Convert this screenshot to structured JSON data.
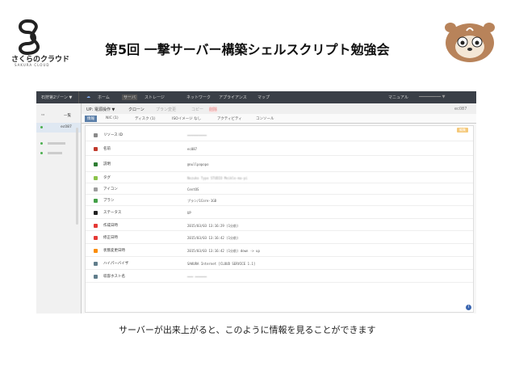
{
  "slide": {
    "title": "第5回 一撃サーバー構築シェルスクリプト勉強会",
    "caption": "サーバーが出来上がると、このように情報を見ることができます",
    "logo_text": "さくらのクラウド",
    "logo_sub": "SAKURA CLOUD"
  },
  "app": {
    "topbar": {
      "zone": "石狩第2ゾーン ▼",
      "home": "ホーム",
      "server": "サーバ",
      "storage": "ストレージ",
      "network": "ネットワーク",
      "appliance": "アプライアンス",
      "map": "マップ",
      "manual": "マニュアル",
      "account": "━━━━━━━━━ ▼"
    },
    "sidebar": {
      "header": "一覧",
      "selected": "ec087"
    },
    "toolbar": {
      "power": "UP: 電源操作 ▼",
      "clone": "クローン",
      "plan_change": "プラン変更",
      "copy": "コピー",
      "delete": "削除",
      "server_id": "ec087"
    },
    "tabs": {
      "info": "情報",
      "nic": "NIC (1)",
      "disk": "ディスク (1)",
      "iso": "ISOイメージ なし",
      "activity": "アクティビティ",
      "console": "コンソール"
    },
    "edit_button": "編集",
    "rows": [
      {
        "label": "リソース ID",
        "value": "━━━━━━━━━━",
        "blur": true,
        "icon_color": "#8a8a8a"
      },
      {
        "label": "名前",
        "value": "ec087",
        "blur": false,
        "icon_color": "#c0392b"
      },
      {
        "label": "説明",
        "value": "@nullpopopo",
        "blur": false,
        "icon_color": "#2e7d32"
      },
      {
        "label": "タグ",
        "value": "Nezuko Type STUDIO Meikle-ma-pi",
        "blur": true,
        "icon_color": "#8bc34a"
      },
      {
        "label": "アイコン",
        "value": "CentOS",
        "blur": false,
        "icon_color": "#9e9e9e"
      },
      {
        "label": "プラン",
        "value": "プラン/1Core-1GB",
        "blur": false,
        "icon_color": "#43a047"
      },
      {
        "label": "ステータス",
        "value": "UP",
        "blur": false,
        "icon_color": "#212121"
      },
      {
        "label": "作成日時",
        "value": "2015/03/03 13:16:29 (1分前)",
        "blur": false,
        "icon_color": "#e53935"
      },
      {
        "label": "修正日時",
        "value": "2015/03/03 13:16:42 (1分前)",
        "blur": false,
        "icon_color": "#e53935"
      },
      {
        "label": "状態変更日時",
        "value": "2015/03/03 13:16:42 (1分前) down -> up",
        "blur": false,
        "icon_color": "#fb8c00"
      },
      {
        "label": "ハイパーバイザ",
        "value": "SAKURA Internet [CLOUD SERVICE 1.1]",
        "blur": false,
        "icon_color": "#607d8b"
      },
      {
        "label": "収容ホスト名",
        "value": "━━━ ━━━━━━",
        "blur": true,
        "icon_color": "#607d8b"
      }
    ],
    "info_icon": "i"
  },
  "colors": {
    "topbar": "#3a3f47",
    "tab_active": "#5a7ea8",
    "edit_button": "#f5c97a",
    "info_icon": "#3b66b0"
  }
}
